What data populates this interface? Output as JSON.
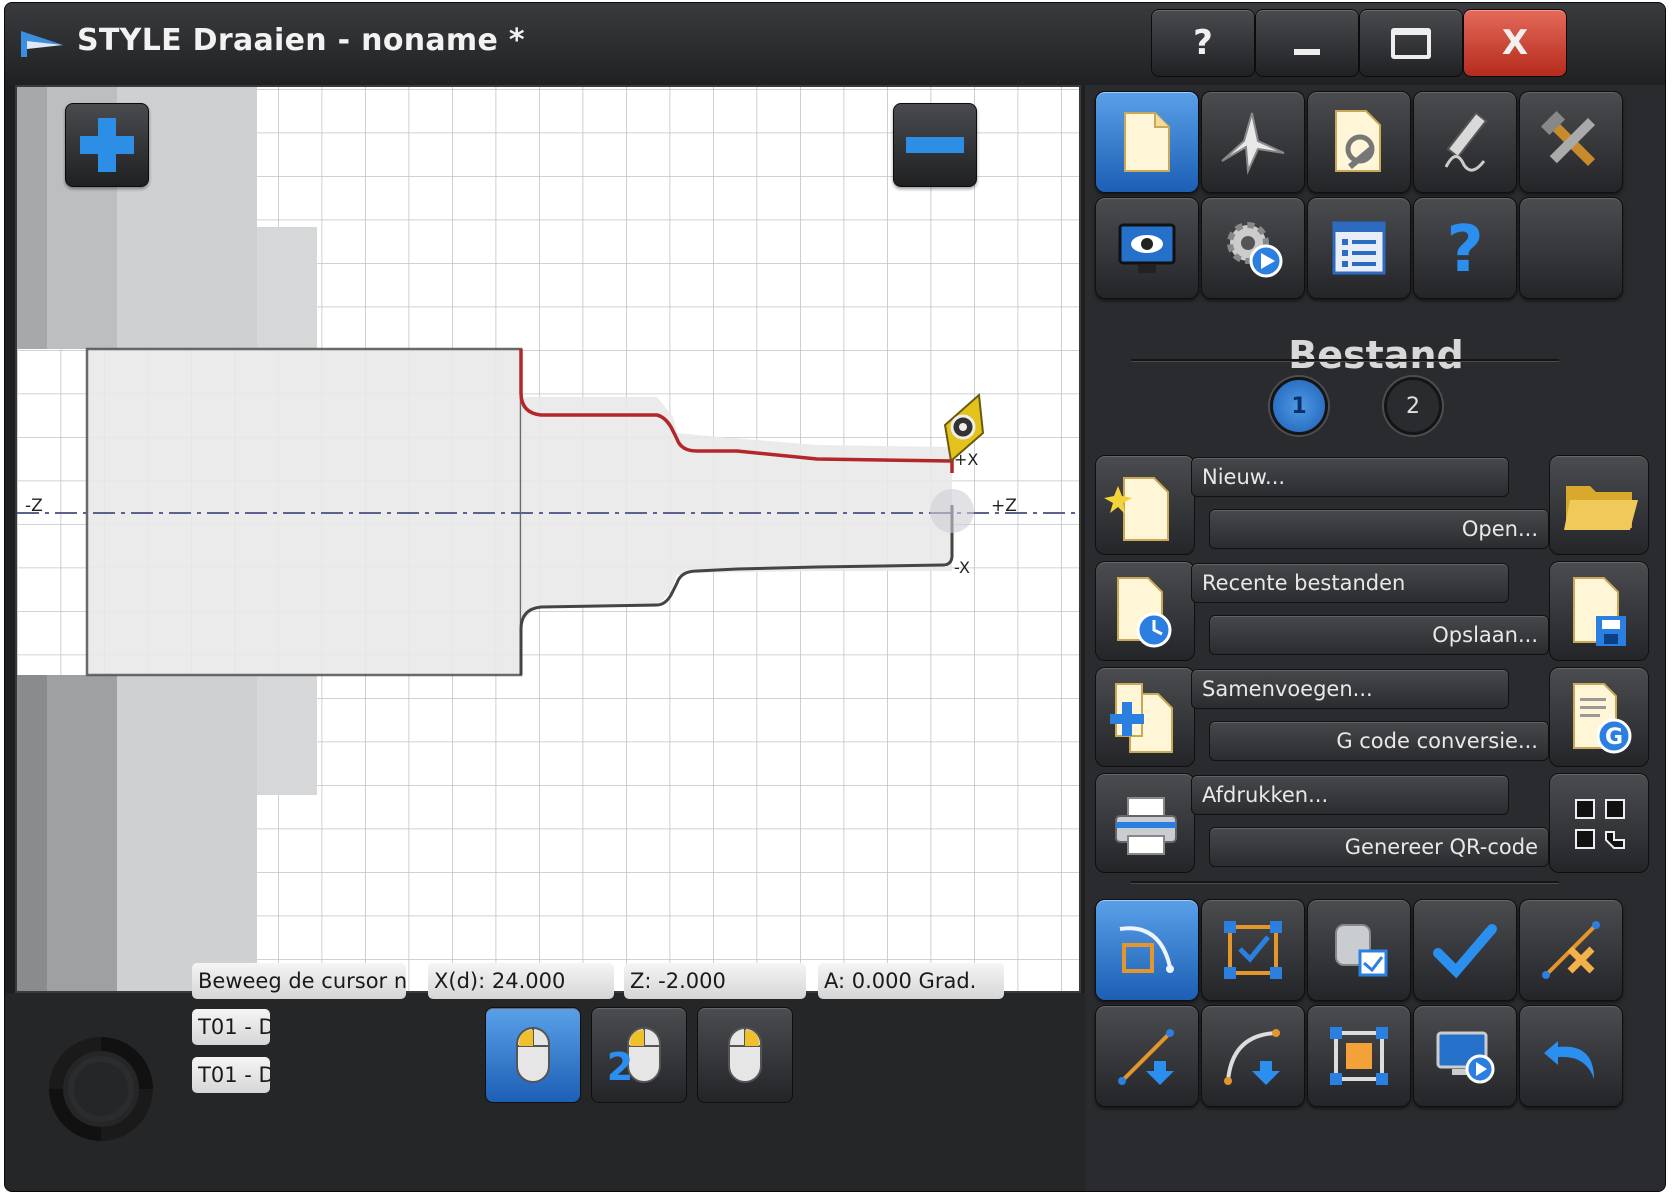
{
  "window": {
    "title": "STYLE Draaien - noname *",
    "controls": {
      "help": "?",
      "minimize": "",
      "maximize": "",
      "close": "X"
    }
  },
  "canvas": {
    "axis_labels": {
      "minus_z": "-Z",
      "plus_z": "+Z",
      "plus_x": "+X",
      "minus_x": "-X"
    },
    "colors": {
      "grid": "#b9bdc2",
      "workpiece": "#e9e9ea",
      "top_contour": "#b3262a",
      "bottom_contour": "#444444",
      "centerline": "#555a88",
      "tool_insert": "#e3c21b"
    }
  },
  "toolbar": {
    "row1": [
      "file-icon",
      "wizard-icon",
      "document-settings-icon",
      "draw-icon",
      "tools-icon"
    ],
    "row2": [
      "view-monitor-icon",
      "simulate-gear-icon",
      "list-icon",
      "help-icon",
      "empty"
    ]
  },
  "section": {
    "title": "Bestand",
    "pages": [
      "1",
      "2"
    ]
  },
  "file_actions": [
    {
      "left_label": "Nieuw...",
      "right_label": "Open...",
      "left_icon": "new-file-icon",
      "right_icon": "folder-icon"
    },
    {
      "left_label": "Recente bestanden",
      "right_label": "Opslaan...",
      "left_icon": "recent-files-icon",
      "right_icon": "save-icon"
    },
    {
      "left_label": "Samenvoegen...",
      "right_label": "G code conversie...",
      "left_icon": "merge-icon",
      "right_icon": "gcode-icon"
    },
    {
      "left_label": "Afdrukken...",
      "right_label": "Genereer QR-code",
      "left_icon": "printer-icon",
      "right_icon": "qr-code-icon"
    }
  ],
  "bottom_tools": {
    "row1": [
      "select-arc-icon",
      "select-frame-icon",
      "part-check-icon",
      "check-icon",
      "delete-line-icon"
    ],
    "row2": [
      "line-tool-icon",
      "arc-tool-icon",
      "frame-tool-icon",
      "monitor-play-icon",
      "undo-icon"
    ]
  },
  "status": {
    "message": "Beweeg de cursor naa",
    "x": "X(d): 24.000",
    "z": "Z: -2.000",
    "a": "A: 0.000 Grad.",
    "tool1": "T01 - D",
    "tool2": "T01 - D"
  },
  "mouse_modes": [
    "mouse-icon",
    "mouse-2-icon",
    "mouse-right-icon"
  ]
}
